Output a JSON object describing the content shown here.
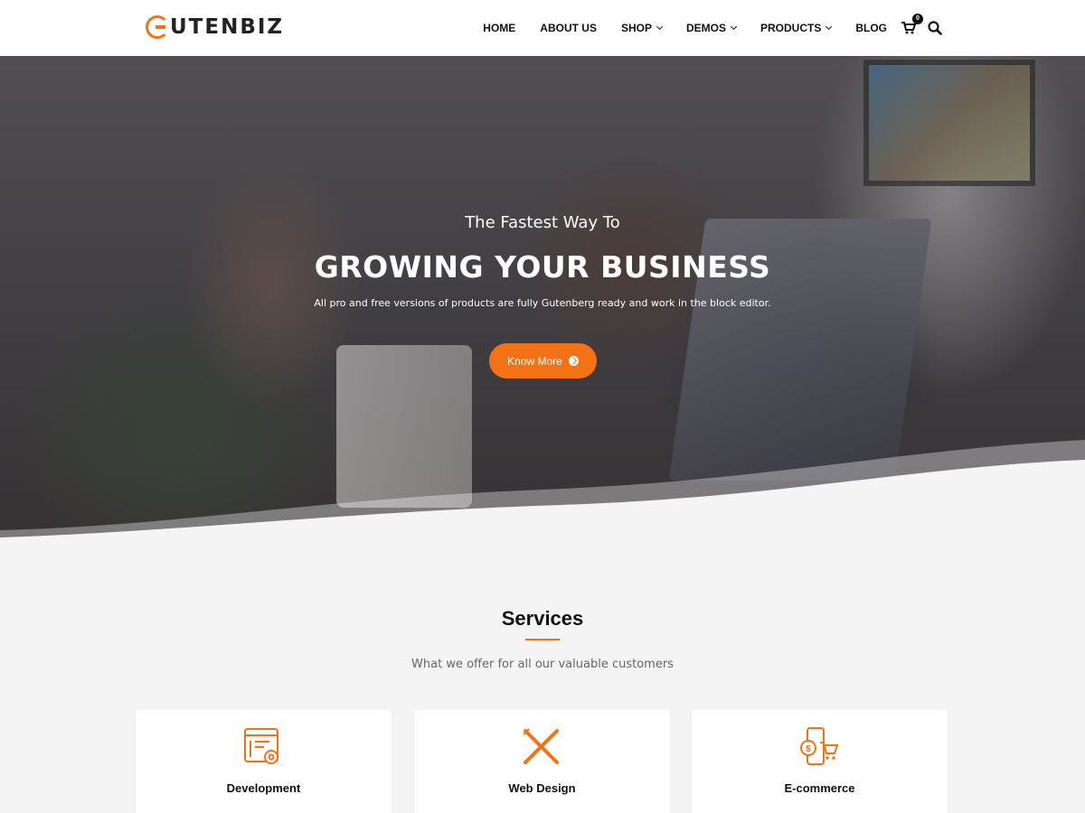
{
  "brand": {
    "logo_text": "UTENBIZ",
    "accent": "#f47216"
  },
  "nav": {
    "items": [
      {
        "label": "HOME",
        "dropdown": false
      },
      {
        "label": "ABOUT US",
        "dropdown": false
      },
      {
        "label": "SHOP",
        "dropdown": true
      },
      {
        "label": "DEMOS",
        "dropdown": true
      },
      {
        "label": "PRODUCTS",
        "dropdown": true
      },
      {
        "label": "BLOG",
        "dropdown": false
      }
    ],
    "cart_count": "0",
    "icons": [
      "cart-icon",
      "search-icon"
    ]
  },
  "hero": {
    "eyebrow": "The Fastest Way To",
    "title": "GROWING YOUR BUSINESS",
    "subtitle": "All pro and free versions of products are fully Gutenberg ready and work in the block editor.",
    "button_label": "Know More"
  },
  "services": {
    "title": "Services",
    "subtitle": "What we offer for all our valuable customers",
    "cards": [
      {
        "label": "Development",
        "icon": "development-icon"
      },
      {
        "label": "Web Design",
        "icon": "web-design-icon"
      },
      {
        "label": "E-commerce",
        "icon": "ecommerce-icon"
      }
    ]
  }
}
